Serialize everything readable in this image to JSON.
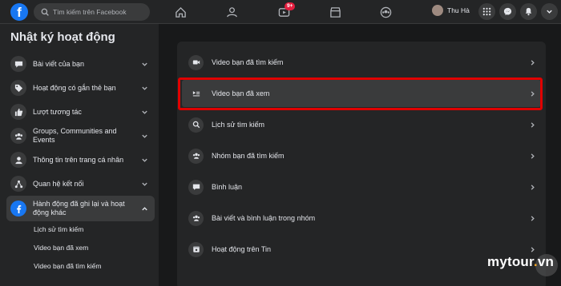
{
  "topbar": {
    "logo": "f",
    "search_placeholder": "Tìm kiếm trên Facebook",
    "watch_badge": "9+",
    "profile_name": "Thu Hà"
  },
  "sidebar": {
    "title": "Nhật ký hoạt động",
    "items": [
      {
        "label": "Bài viết của bạn",
        "icon": "chat-icon"
      },
      {
        "label": "Hoạt động có gắn thẻ bạn",
        "icon": "tag-icon"
      },
      {
        "label": "Lượt tương tác",
        "icon": "like-icon"
      },
      {
        "label": "Groups, Communities and Events",
        "icon": "group-icon"
      },
      {
        "label": "Thông tin trên trang cá nhân",
        "icon": "profile-icon"
      },
      {
        "label": "Quan hệ kết nối",
        "icon": "connections-icon"
      },
      {
        "label": "Hành động đã ghi lại và hoạt động khác",
        "icon": "facebook-icon"
      }
    ],
    "sub_items": [
      "Lịch sử tìm kiếm",
      "Video bạn đã xem",
      "Video bạn đã tìm kiếm"
    ]
  },
  "main": {
    "rows": [
      {
        "label": "Video bạn đã tìm kiếm",
        "icon": "video-camera-icon"
      },
      {
        "label": "Video bạn đã xem",
        "icon": "watch-list-icon"
      },
      {
        "label": "Lịch sử tìm kiếm",
        "icon": "search-icon"
      },
      {
        "label": "Nhóm bạn đã tìm kiếm",
        "icon": "group-icon"
      },
      {
        "label": "Bình luận",
        "icon": "comment-icon"
      },
      {
        "label": "Bài viết và bình luận trong nhóm",
        "icon": "group-post-icon"
      },
      {
        "label": "Hoạt động trên Tin",
        "icon": "story-icon"
      }
    ]
  },
  "watermark": {
    "brand": "mytour",
    "dot": ".",
    "tld": "vn"
  },
  "colors": {
    "accent": "#1877f2",
    "highlight": "#e00000",
    "badge": "#e41e3f"
  }
}
